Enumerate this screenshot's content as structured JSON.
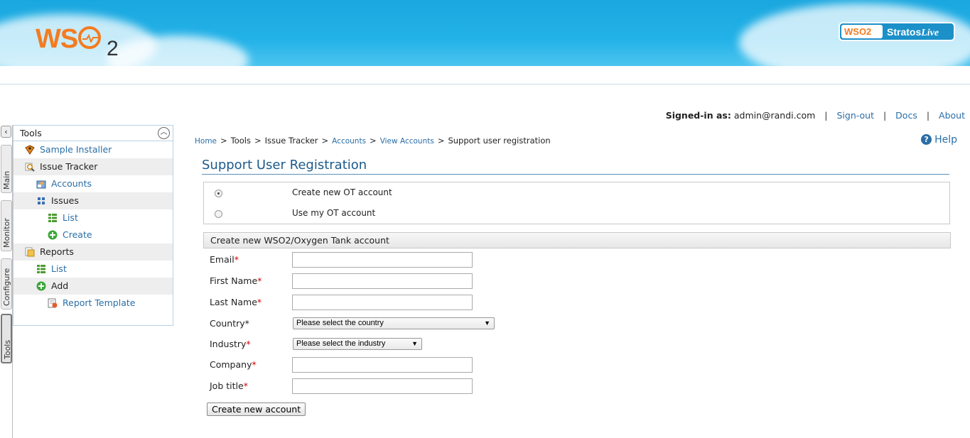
{
  "header": {
    "logo_text": "WS",
    "logo_sub": "2",
    "badge_left": "WSO2",
    "badge_brand": "Stratos",
    "badge_live": "Live"
  },
  "toplinks": {
    "signed_in_label": "Signed-in as:",
    "user": "admin@randi.com",
    "signout": "Sign-out",
    "docs": "Docs",
    "about": "About",
    "sep": "|"
  },
  "vtabs": {
    "collapse": "‹",
    "main": "Main",
    "monitor": "Monitor",
    "configure": "Configure",
    "tools": "Tools"
  },
  "sidebar": {
    "title": "Tools",
    "items": [
      {
        "label": "Sample Installer"
      },
      {
        "label": "Issue Tracker"
      },
      {
        "label": "Accounts"
      },
      {
        "label": "Issues"
      },
      {
        "label": "List"
      },
      {
        "label": "Create"
      },
      {
        "label": "Reports"
      },
      {
        "label": "List"
      },
      {
        "label": "Add"
      },
      {
        "label": "Report Template"
      }
    ]
  },
  "breadcrumb": {
    "home": "Home",
    "tools": "Tools",
    "issue_tracker": "Issue Tracker",
    "accounts": "Accounts",
    "view_accounts": "View Accounts",
    "current": "Support user registration",
    "gt": ">"
  },
  "help": "Help",
  "page_title": "Support User Registration",
  "options": {
    "create_new": "Create new OT account",
    "use_my": "Use my OT account",
    "selected": "create_new"
  },
  "form": {
    "section_title": "Create new WSO2/Oxygen Tank account",
    "email": "Email",
    "first_name": "First Name",
    "last_name": "Last Name",
    "country": "Country*",
    "industry": "Industry",
    "company": "Company",
    "job_title": "Job title",
    "star": "*",
    "country_select": "Please select the country",
    "industry_select": "Please select the industry",
    "submit": "Create new account"
  },
  "colors": {
    "header_blue": "#1aa7df",
    "link_blue": "#2a6ea6",
    "wso2_orange": "#f47b20",
    "required_red": "#d40000"
  }
}
